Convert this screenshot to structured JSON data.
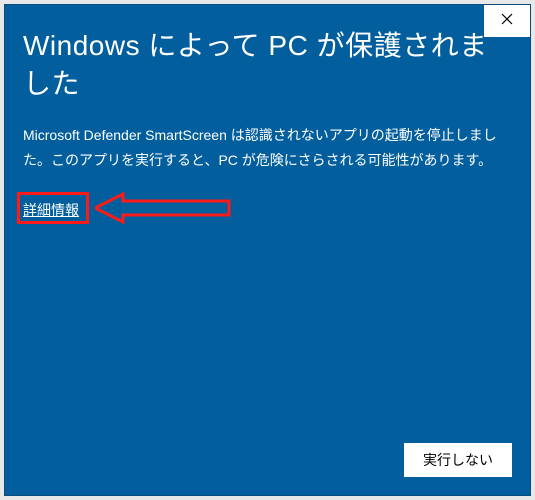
{
  "dialog": {
    "title": "Windows によって PC が保護されました",
    "body": "Microsoft Defender SmartScreen は認識されないアプリの起動を停止しました。このアプリを実行すると、PC が危険にさらされる可能性があります。",
    "more_info_label": "詳細情報",
    "dont_run_label": "実行しない"
  },
  "annotation": {
    "highlight_color": "#ff1a1a"
  }
}
